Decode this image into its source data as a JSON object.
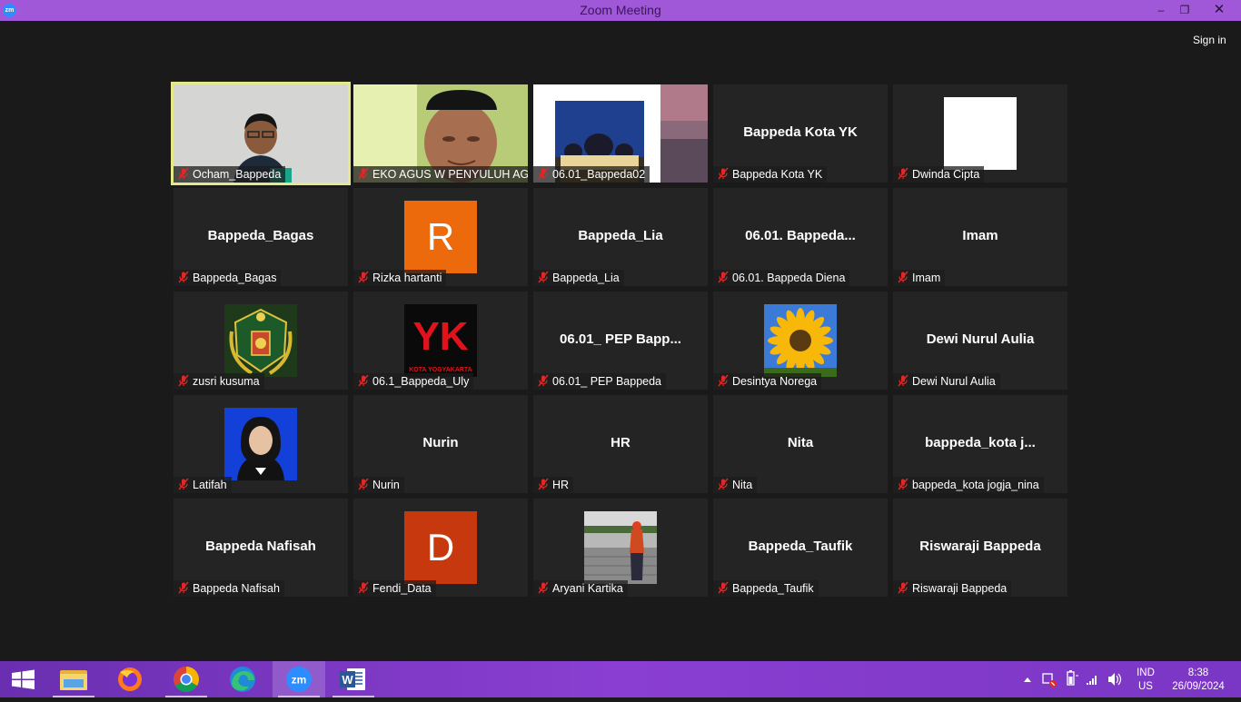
{
  "window": {
    "title": "Zoom Meeting",
    "app_icon_label": "zm",
    "sign_in": "Sign in"
  },
  "participants": [
    {
      "name": "Ocham_Bappeda",
      "display": "",
      "type": "video-person",
      "active": true
    },
    {
      "name": "EKO AGUS W PENYULUH AGA...",
      "display": "",
      "type": "video-person2"
    },
    {
      "name": "06.01_Bappeda02",
      "display": "",
      "type": "video-mosque"
    },
    {
      "name": "Bappeda Kota YK",
      "display": "Bappeda Kota YK",
      "type": "text"
    },
    {
      "name": "Dwinda Cipta",
      "display": "",
      "type": "white-square"
    },
    {
      "name": "Bappeda_Bagas",
      "display": "Bappeda_Bagas",
      "type": "text"
    },
    {
      "name": "Rizka hartanti",
      "display": "R",
      "type": "initial",
      "color": "#ed6a0c"
    },
    {
      "name": "Bappeda_Lia",
      "display": "Bappeda_Lia",
      "type": "text"
    },
    {
      "name": "06.01. Bappeda Diena",
      "display": "06.01. Bappeda...",
      "type": "text"
    },
    {
      "name": "Imam",
      "display": "Imam",
      "type": "text"
    },
    {
      "name": "zusri kusuma",
      "display": "",
      "type": "emblem"
    },
    {
      "name": "06.1_Bappeda_Uly",
      "display": "",
      "type": "yk-logo",
      "logo_text": "YK",
      "logo_sub": "KOTA YOGYAKARTA"
    },
    {
      "name": "06.01_ PEP Bappeda",
      "display": "06.01_ PEP Bapp...",
      "type": "text"
    },
    {
      "name": "Desintya Norega",
      "display": "",
      "type": "sunflower"
    },
    {
      "name": "Dewi Nurul Aulia",
      "display": "Dewi Nurul Aulia",
      "type": "text"
    },
    {
      "name": "Latifah",
      "display": "",
      "type": "portrait"
    },
    {
      "name": "Nurin",
      "display": "Nurin",
      "type": "text"
    },
    {
      "name": "HR",
      "display": "HR",
      "type": "text"
    },
    {
      "name": "Nita",
      "display": "Nita",
      "type": "text"
    },
    {
      "name": "bappeda_kota jogja_nina",
      "display": "bappeda_kota  j...",
      "type": "text"
    },
    {
      "name": "Bappeda Nafisah",
      "display": "Bappeda Nafisah",
      "type": "text"
    },
    {
      "name": "Fendi_Data",
      "display": "D",
      "type": "initial",
      "color": "#c8380e"
    },
    {
      "name": "Aryani Kartika",
      "display": "",
      "type": "street-photo"
    },
    {
      "name": "Bappeda_Taufik",
      "display": "Bappeda_Taufik",
      "type": "text"
    },
    {
      "name": "Riswaraji Bappeda",
      "display": "Riswaraji Bappeda",
      "type": "text"
    }
  ],
  "taskbar": {
    "apps": [
      "start-button",
      "file-explorer",
      "firefox",
      "chrome",
      "edge",
      "zoom",
      "word"
    ],
    "zoom_label": "zm",
    "word_label": "W",
    "language": {
      "line1": "IND",
      "line2": "US"
    },
    "clock": {
      "time": "8:38",
      "date": "26/09/2024"
    }
  },
  "colors": {
    "title_bar": "#a057d8",
    "active_speaker_border": "#e5e88a",
    "mute": "#e02828",
    "taskbar": "#7a36c4"
  }
}
